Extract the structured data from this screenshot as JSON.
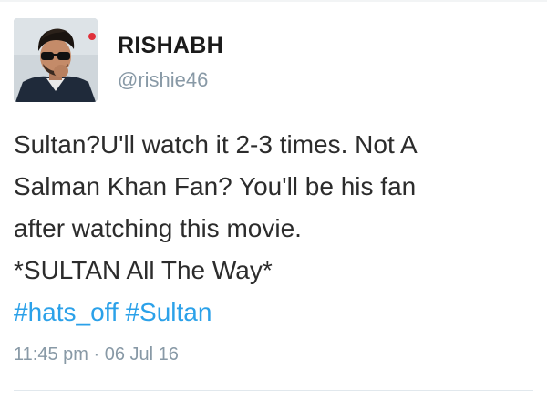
{
  "tweet": {
    "author": {
      "display_name": "RISHABH",
      "handle": "@rishie46",
      "avatar_icon": "user-avatar"
    },
    "text_lines": [
      "Sultan?U'll watch it 2-3 times. Not A",
      "Salman Khan Fan? You'll be his fan",
      "after watching this movie.",
      "*SULTAN All The Way*"
    ],
    "hashtags": [
      "#hats_off",
      "#Sultan"
    ],
    "time": "11:45 pm",
    "separator": "·",
    "date": "06 Jul 16",
    "colors": {
      "link": "#2ba1e9",
      "secondary_text": "#8899a6",
      "primary_text": "#2c2c2c"
    }
  }
}
